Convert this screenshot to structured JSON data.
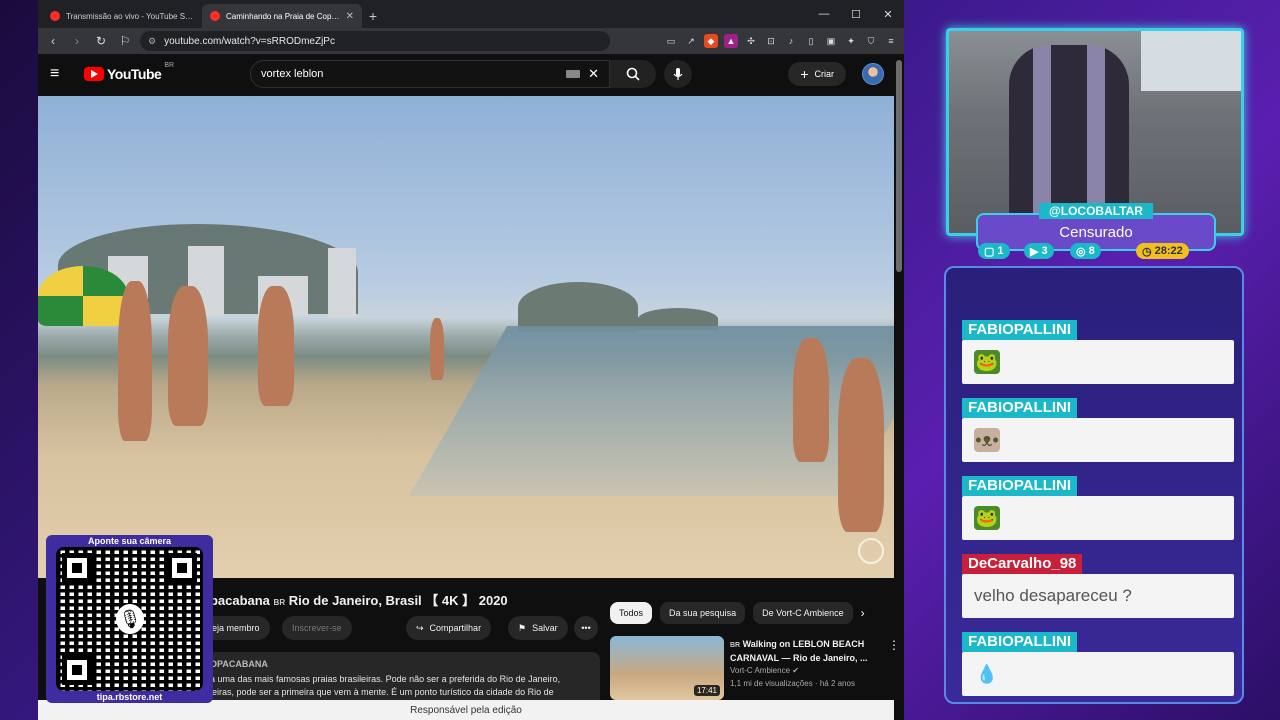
{
  "browser": {
    "tabs": [
      {
        "title": "Transmissão ao vivo - YouTube Studio",
        "active": false
      },
      {
        "title": "Caminhando na Praia de Copacabana",
        "active": true
      }
    ],
    "url": "youtube.com/watch?v=sRRODmeZjPc"
  },
  "youtube": {
    "logo_text": "YouTube",
    "region": "BR",
    "search_value": "vortex leblon",
    "create_label": "Criar"
  },
  "video": {
    "title_prefix": "opacabana",
    "title_badge": "BR",
    "title_rest": "Rio de Janeiro, Brasil 【 4K 】 2020",
    "member_label": "eja membro",
    "subscribe_label": "Inscrever-se",
    "share_label": "Compartilhar",
    "save_label": "Salvar",
    "more_label": "•••",
    "desc_channel": "OPACABANA",
    "desc_line1": "a uma das mais famosas praias brasileiras. Pode não ser a preferida do Rio de Janeiro,",
    "desc_line2": "leiras, pode ser a primeira que vem à mente. É um ponto turístico da cidade do Rio de"
  },
  "filters": {
    "chips": [
      "Todos",
      "Da sua pesquisa",
      "De Vort-C Ambience"
    ]
  },
  "recommendation": {
    "flag": "BR",
    "title": "Walking on LEBLON BEACH CARNAVAL — Rio de Janeiro, ...",
    "channel": "Vort-C Ambience",
    "meta": "1,1 mi de visualizações · há 2 anos",
    "duration": "17:41"
  },
  "statusbar": {
    "text": "Responsável pela edição"
  },
  "qr": {
    "top_text": "Aponte sua câmera",
    "bottom_text": "tipa.rbstore.net"
  },
  "stream": {
    "username": "@LOCOBALTAR",
    "status": "Censurado",
    "badges": [
      {
        "icon": "twitch-icon",
        "value": "1"
      },
      {
        "icon": "youtube-icon",
        "value": "3"
      },
      {
        "icon": "kick-icon",
        "value": "8"
      },
      {
        "icon": "clock-icon",
        "value": "28:22"
      }
    ]
  },
  "chat": {
    "messages": [
      {
        "user": "FABIOPALLINI",
        "user_color": "#1ab8c8",
        "text": "",
        "emote": "frog-emote-icon"
      },
      {
        "user": "FABIOPALLINI",
        "user_color": "#1ab8c8",
        "text": "",
        "emote": "face-emote-icon"
      },
      {
        "user": "FABIOPALLINI",
        "user_color": "#1ab8c8",
        "text": "",
        "emote": "frog-emote-icon"
      },
      {
        "user": "DeCarvalho_98",
        "user_color": "#c8203a",
        "text": "velho desapareceu ?",
        "emote": ""
      },
      {
        "user": "FABIOPALLINI",
        "user_color": "#1ab8c8",
        "text": "",
        "emote": "droplet-emote-icon"
      }
    ]
  }
}
